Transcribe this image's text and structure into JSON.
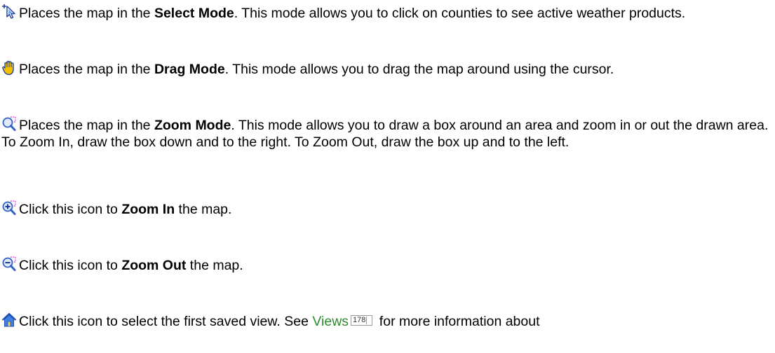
{
  "items": [
    {
      "icon": "select-mode-icon",
      "pre": "Places the map in the ",
      "bold": "Select Mode",
      "post": ".  This mode allows you to click on counties to see active weather products."
    },
    {
      "icon": "drag-hand-icon",
      "pre": "Places the map in the ",
      "bold": "Drag Mode",
      "post": ".  This mode allows you to drag the map around using the cursor."
    },
    {
      "icon": "zoom-mode-icon",
      "pre": "Places the map in the ",
      "bold": "Zoom Mode",
      "post": ". This mode allows you to draw a box around an area and zoom in or out the drawn area.  To Zoom In, draw the box down and to the right.  To Zoom Out, draw the box up and to the left."
    },
    {
      "icon": "zoom-in-icon",
      "pre": "Click this icon to ",
      "bold": "Zoom In",
      "post": " the map."
    },
    {
      "icon": "zoom-out-icon",
      "pre": "Click this icon to ",
      "bold": "Zoom Out",
      "post": " the map."
    },
    {
      "icon": "home-icon",
      "pre": "Click this icon to select the first saved view.  See ",
      "link": "Views",
      "page_ref": "178",
      "post": " for more information about"
    }
  ],
  "colors": {
    "link": "#2e8b2e",
    "icon_blue": "#2f62c8",
    "icon_magenta": "#d400d4"
  }
}
